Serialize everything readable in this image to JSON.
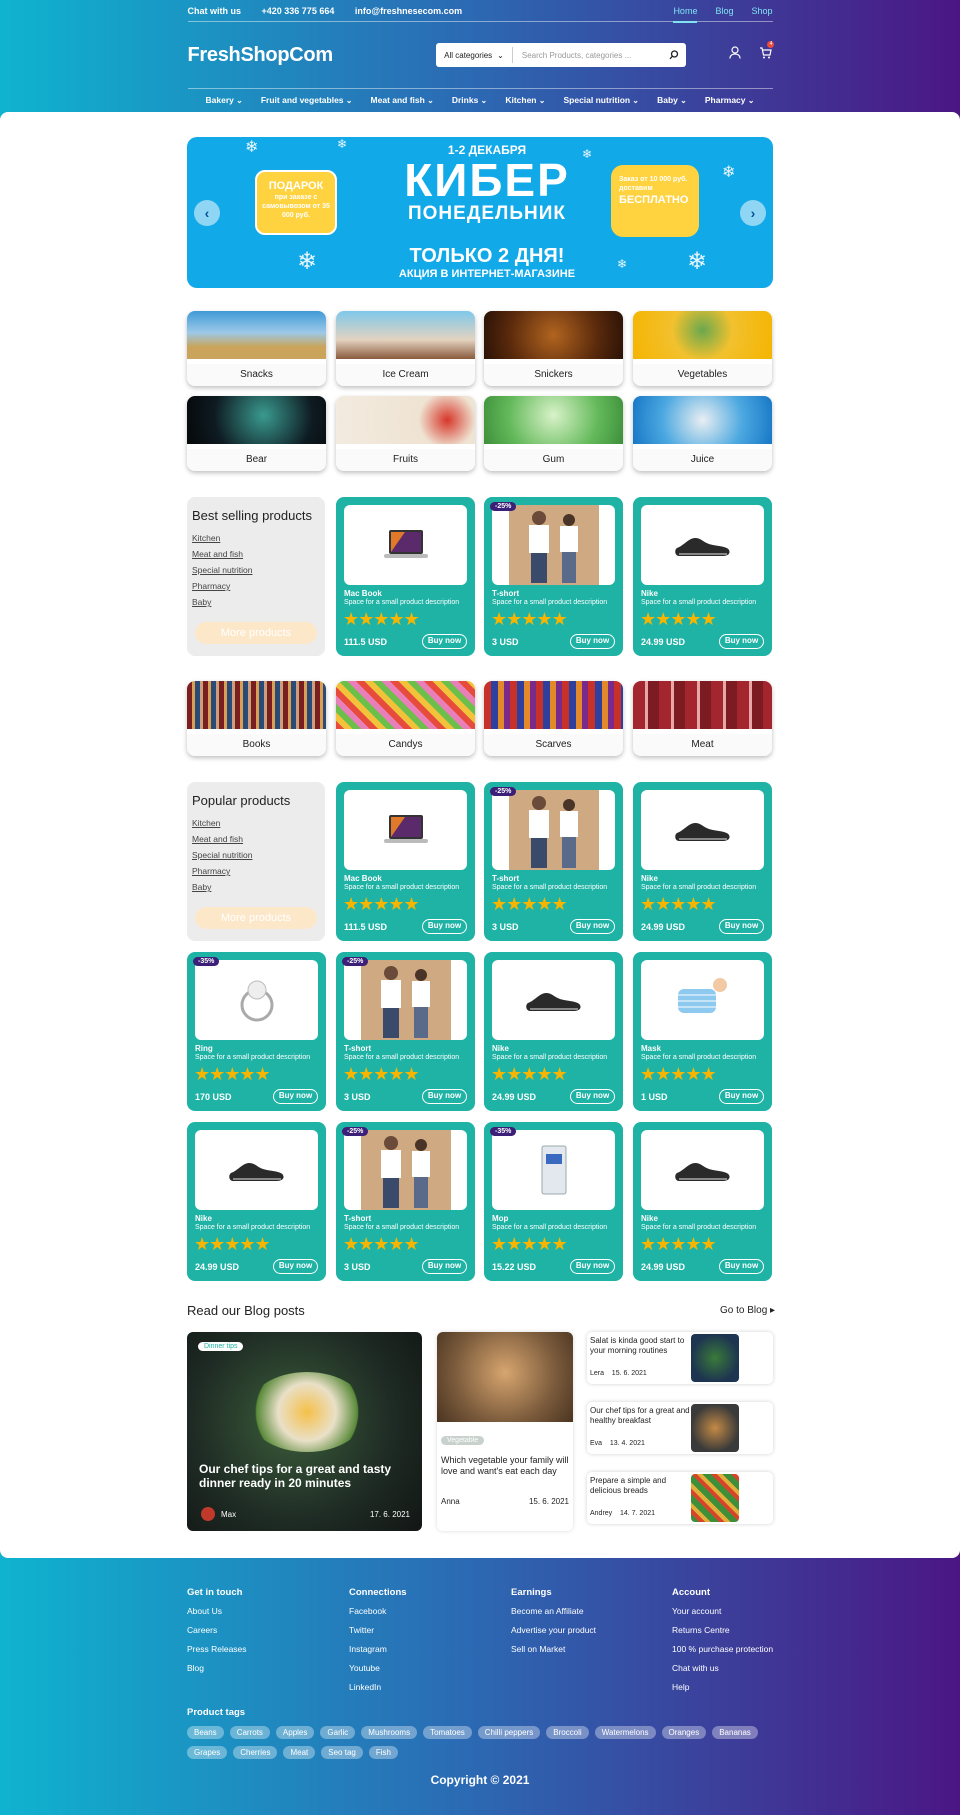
{
  "topbar": {
    "chat": "Chat with us",
    "phone": "+420 336 775 664",
    "email": "info@freshnesecom.com",
    "links": [
      "Home",
      "Blog",
      "Shop"
    ]
  },
  "header": {
    "logo": "FreshShopCom",
    "category": "All categories",
    "search_placeholder": "Search Products, categories ...",
    "cart_count": "4"
  },
  "nav": [
    "Bakery",
    "Fruit and vegetables",
    "Meat and fish",
    "Drinks",
    "Kitchen",
    "Special nutrition",
    "Baby",
    "Pharmacy"
  ],
  "banner": {
    "date": "1-2 ДЕКАБРЯ",
    "title1": "КИБЕР",
    "title2": "ПОНЕДЕЛЬНИК",
    "only": "ТОЛЬКО 2 ДНЯ!",
    "action": "АКЦИЯ В ИНТЕРНЕТ-МАГАЗИНЕ",
    "gift_title": "ПОДАРОК",
    "gift_text": "при заказе с самовывозом от 35 000 руб.",
    "delivery_text": "Заказ от 10 000 руб. доставим",
    "delivery_free": "БЕСПЛАТНО"
  },
  "categories1": [
    "Snacks",
    "Ice Cream",
    "Snickers",
    "Vegetables",
    "Bear",
    "Fruits",
    "Gum",
    "Juice"
  ],
  "categories2": [
    "Books",
    "Candys",
    "Scarves",
    "Meat"
  ],
  "side1": {
    "title": "Best selling products",
    "links": [
      "Kitchen",
      "Meat and fish",
      "Special nutrition",
      "Pharmacy",
      "Baby"
    ],
    "more": "More products"
  },
  "side2": {
    "title": "Popular products",
    "links": [
      "Kitchen",
      "Meat and fish",
      "Special nutrition",
      "Pharmacy",
      "Baby"
    ],
    "more": "More products"
  },
  "product_desc": "Space for a small product description",
  "stars": "★★★★★",
  "buy": "Buy now",
  "best": [
    {
      "name": "Mac Book",
      "price": "111.5 USD",
      "badge": ""
    },
    {
      "name": "T-short",
      "price": "3 USD",
      "badge": "-25%"
    },
    {
      "name": "Nike",
      "price": "24.99 USD",
      "badge": ""
    }
  ],
  "popular": [
    {
      "name": "Mac Book",
      "price": "111.5 USD",
      "badge": ""
    },
    {
      "name": "T-short",
      "price": "3 USD",
      "badge": "-25%"
    },
    {
      "name": "Nike",
      "price": "24.99 USD",
      "badge": ""
    },
    {
      "name": "Ring",
      "price": "170 USD",
      "badge": "-35%"
    },
    {
      "name": "T-short",
      "price": "3 USD",
      "badge": "-25%"
    },
    {
      "name": "Nike",
      "price": "24.99 USD",
      "badge": ""
    },
    {
      "name": "Mask",
      "price": "1 USD",
      "badge": ""
    },
    {
      "name": "Nike",
      "price": "24.99 USD",
      "badge": ""
    },
    {
      "name": "T-short",
      "price": "3 USD",
      "badge": "-25%"
    },
    {
      "name": "Mop",
      "price": "15.22 USD",
      "badge": "-35%"
    },
    {
      "name": "Nike",
      "price": "24.99 USD",
      "badge": ""
    }
  ],
  "blog": {
    "heading": "Read our Blog posts",
    "go": "Go to Blog",
    "big": {
      "tag": "Dinner tips",
      "title": "Our chef tips for a great and tasty dinner ready in 20 minutes",
      "author": "Max",
      "date": "17. 6. 2021"
    },
    "mid": {
      "tag": "Vegetable",
      "title": "Which vegetable your family will love and want's eat each day",
      "author": "Anna",
      "date": "15. 6. 2021"
    },
    "small": [
      {
        "title": "Salat is kinda good start to your morning routines",
        "author": "Lera",
        "date": "15. 6. 2021"
      },
      {
        "title": "Our chef tips for a great and healthy breakfast",
        "author": "Eva",
        "date": "13. 4. 2021"
      },
      {
        "title": "Prepare a simple and delicious breads",
        "author": "Andrey",
        "date": "14. 7. 2021"
      }
    ]
  },
  "footer": {
    "cols": [
      {
        "title": "Get in touch",
        "items": [
          "About Us",
          "Careers",
          "Press Releases",
          "Blog"
        ]
      },
      {
        "title": "Connections",
        "items": [
          "Facebook",
          "Twitter",
          "Instagram",
          "Youtube",
          "LinkedIn"
        ]
      },
      {
        "title": "Earnings",
        "items": [
          "Become an Affiliate",
          "Advertise your product",
          "Sell on Market"
        ]
      },
      {
        "title": "Account",
        "items": [
          "Your account",
          "Returns Centre",
          "100 % purchase protection",
          "Chat with us",
          "Help"
        ]
      }
    ],
    "tags_title": "Product tags",
    "tags": [
      "Beans",
      "Carrots",
      "Apples",
      "Garlic",
      "Mushrooms",
      "Tomatoes",
      "Chilli peppers",
      "Broccoli",
      "Watermelons",
      "Oranges",
      "Bananas",
      "Grapes",
      "Cherries",
      "Meat",
      "Seo tag",
      "Fish"
    ],
    "copyright": "Copyright © 2021"
  }
}
